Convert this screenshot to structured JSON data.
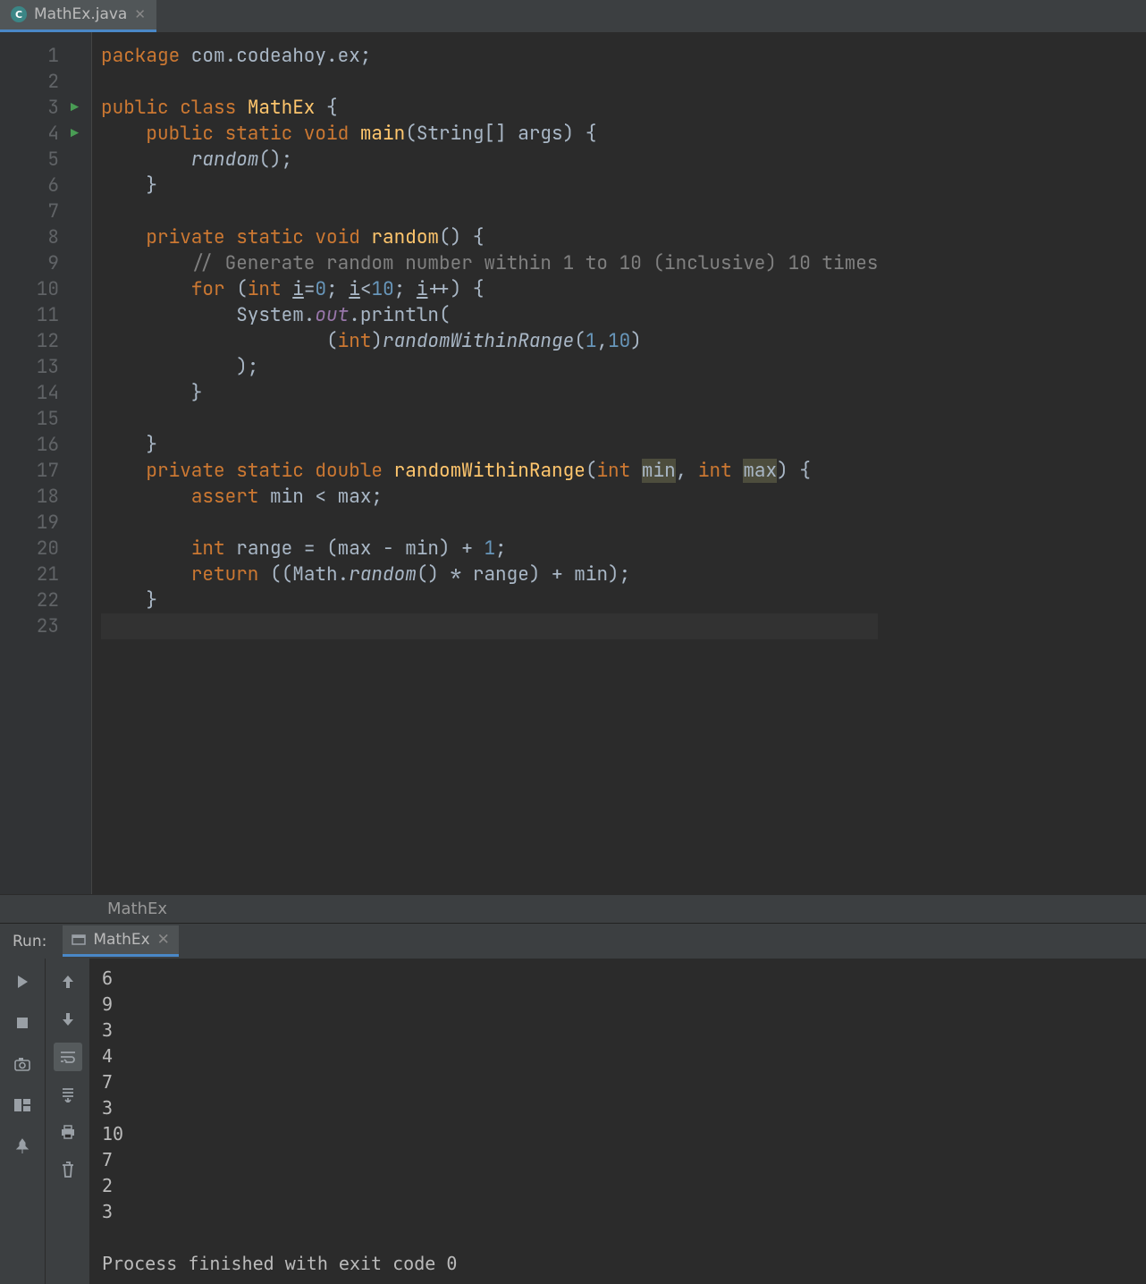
{
  "editor_tab": {
    "label": "MathEx.java",
    "icon_letter": "C"
  },
  "breadcrumb": "MathEx",
  "code_lines": [
    {
      "n": 1,
      "html": "<span class='kw'>package</span> com.codeahoy.ex;"
    },
    {
      "n": 2,
      "html": ""
    },
    {
      "n": 3,
      "run": true,
      "html": "<span class='kw'>public class</span> <span class='fn'>MathEx</span> {"
    },
    {
      "n": 4,
      "run": true,
      "html": "    <span class='kw'>public static void</span> <span class='fn'>main</span>(String[] args) {"
    },
    {
      "n": 5,
      "html": "        <span class='it2'>random</span>();"
    },
    {
      "n": 6,
      "html": "    }"
    },
    {
      "n": 7,
      "html": ""
    },
    {
      "n": 8,
      "html": "    <span class='kw'>private static void</span> <span class='fn'>random</span>() {"
    },
    {
      "n": 9,
      "html": "        <span class='cmt'>// Generate random number within 1 to 10 (inclusive) 10 times</span>"
    },
    {
      "n": 10,
      "html": "        <span class='kw'>for</span> (<span class='kw'>int</span> <u>i</u>=<span class='num'>0</span>; <u>i</u>&lt;<span class='num'>10</span>; <u>i</u>++) {"
    },
    {
      "n": 11,
      "html": "            System.<span class='ital'>out</span>.println("
    },
    {
      "n": 12,
      "html": "                    (<span class='kw'>int</span>)<span class='it2'>randomWithinRange</span>(<span class='num'>1</span>,<span class='num'>10</span>)"
    },
    {
      "n": 13,
      "html": "            );"
    },
    {
      "n": 14,
      "html": "        }"
    },
    {
      "n": 15,
      "html": ""
    },
    {
      "n": 16,
      "html": "    }"
    },
    {
      "n": 17,
      "html": "    <span class='kw'>private static</span> <span class='kw'>double</span> <span class='fn'>randomWithinRange</span>(<span class='kw'>int</span> <span class='hl'>min</span>, <span class='kw'>int</span> <span class='hl'>max</span>) {"
    },
    {
      "n": 18,
      "html": "        <span class='kw'>assert</span> min &lt; max;"
    },
    {
      "n": 19,
      "html": ""
    },
    {
      "n": 20,
      "html": "        <span class='kw'>int</span> range = (max - min) + <span class='num'>1</span>;"
    },
    {
      "n": 21,
      "html": "        <span class='kw'>return</span> ((Math.<span class='it2'>random</span>() * range) + min);"
    },
    {
      "n": 22,
      "html": "    }"
    },
    {
      "n": 23,
      "html": "",
      "caret": true
    }
  ],
  "run": {
    "label": "Run:",
    "tab_name": "MathEx",
    "output_lines": [
      "6",
      "9",
      "3",
      "4",
      "7",
      "3",
      "10",
      "7",
      "2",
      "3"
    ],
    "exit_message": "Process finished with exit code 0"
  },
  "tool_icons_left": [
    "play",
    "stop",
    "camera",
    "layout",
    "pin"
  ],
  "tool_icons_right": [
    "up",
    "down",
    "wrap",
    "scroll",
    "print",
    "trash"
  ]
}
